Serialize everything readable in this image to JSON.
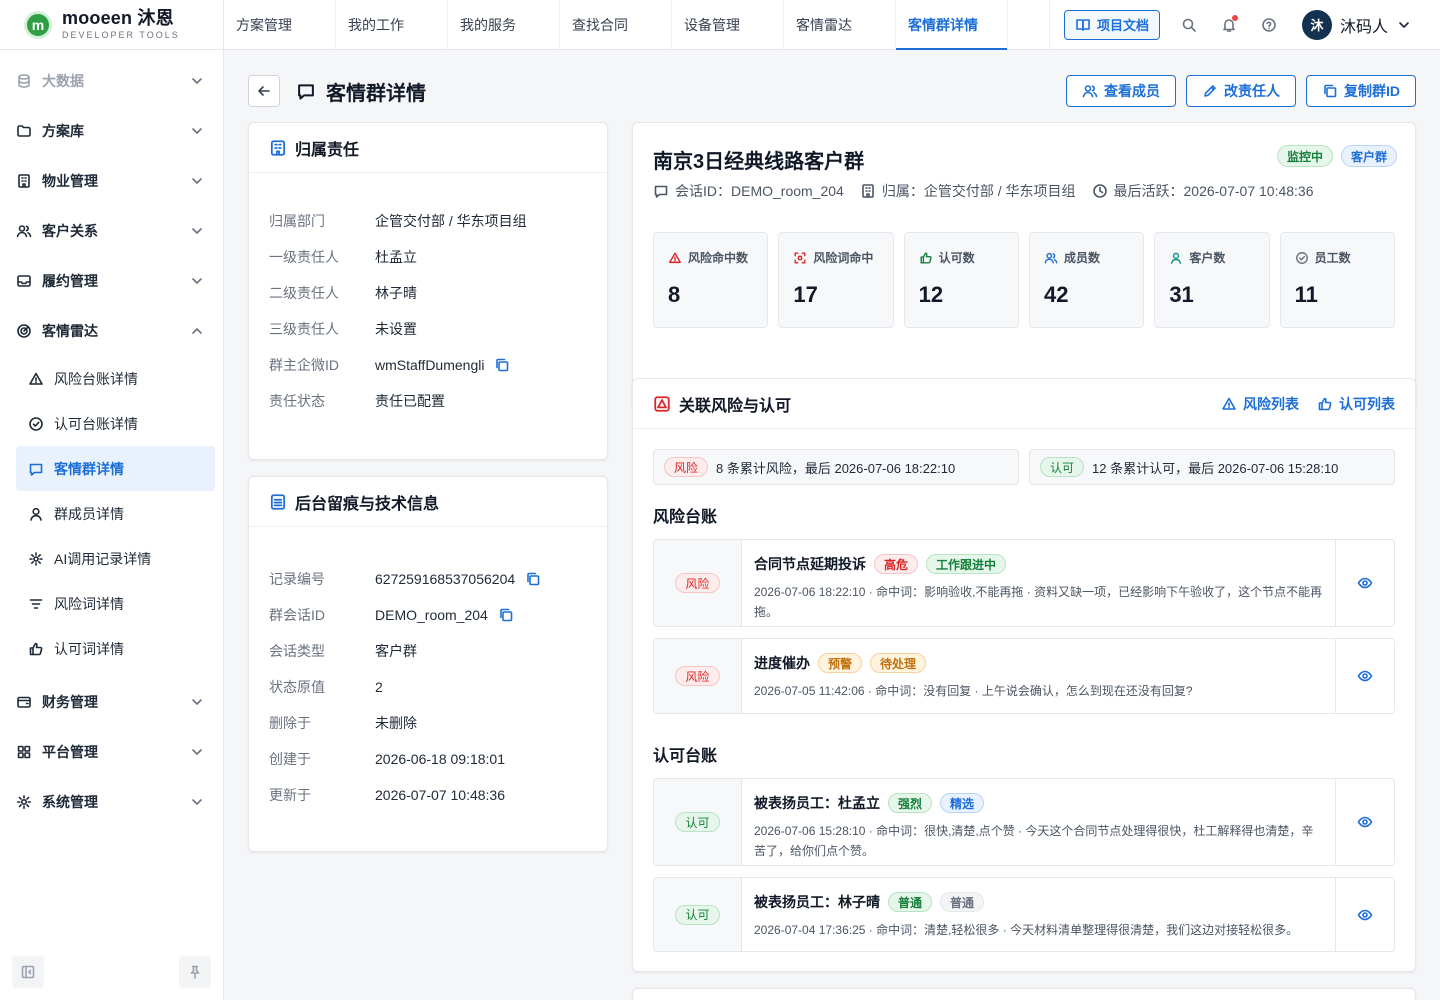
{
  "brand": {
    "name": "mooeen 沐恩",
    "subtitle": "DEVELOPER TOOLS",
    "logo_letter": "m"
  },
  "topnav": [
    {
      "label": "方案管理"
    },
    {
      "label": "我的工作"
    },
    {
      "label": "我的服务"
    },
    {
      "label": "查找合同"
    },
    {
      "label": "设备管理"
    },
    {
      "label": "客情雷达"
    },
    {
      "label": "客情群详情",
      "active": true
    }
  ],
  "topbar": {
    "doc_button": "项目文档",
    "user_initial": "沐",
    "user_name": "沐码人"
  },
  "sidebar": {
    "groups": [
      {
        "label": "大数据",
        "icon": "database-icon"
      },
      {
        "label": "方案库",
        "icon": "folder-icon"
      },
      {
        "label": "物业管理",
        "icon": "building-icon"
      },
      {
        "label": "客户关系",
        "icon": "users-icon"
      },
      {
        "label": "履约管理",
        "icon": "inbox-icon"
      },
      {
        "label": "客情雷达",
        "icon": "radar-icon"
      }
    ],
    "radar_items": [
      {
        "label": "风险台账详情",
        "icon": "warning-icon"
      },
      {
        "label": "认可台账详情",
        "icon": "check-circle-icon"
      },
      {
        "label": "客情群详情",
        "icon": "message-icon",
        "active": true
      },
      {
        "label": "群成员详情",
        "icon": "user-icon"
      },
      {
        "label": "AI调用记录详情",
        "icon": "ai-icon"
      },
      {
        "label": "风险词详情",
        "icon": "filter-icon"
      },
      {
        "label": "认可词详情",
        "icon": "thumbs-up-icon"
      }
    ],
    "bottom_groups": [
      {
        "label": "财务管理",
        "icon": "wallet-icon"
      },
      {
        "label": "平台管理",
        "icon": "grid-icon"
      },
      {
        "label": "系统管理",
        "icon": "gear-icon"
      }
    ]
  },
  "page": {
    "title": "客情群详情",
    "actions": [
      {
        "label": "查看成员",
        "icon": "users-icon"
      },
      {
        "label": "改责任人",
        "icon": "pencil-icon"
      },
      {
        "label": "复制群ID",
        "icon": "copy-icon"
      }
    ]
  },
  "ownership": {
    "title": "归属责任",
    "rows": [
      {
        "key": "归属部门",
        "value": "企管交付部 / 华东项目组"
      },
      {
        "key": "一级责任人",
        "value": "杜孟立"
      },
      {
        "key": "二级责任人",
        "value": "林子晴"
      },
      {
        "key": "三级责任人",
        "value": "未设置"
      },
      {
        "key": "群主企微ID",
        "value": "wmStaffDumengli",
        "copy": true
      },
      {
        "key": "责任状态",
        "value": "责任已配置"
      }
    ]
  },
  "tech": {
    "title": "后台留痕与技术信息",
    "rows": [
      {
        "key": "记录编号",
        "value": "627259168537056204",
        "copy": true
      },
      {
        "key": "群会话ID",
        "value": "DEMO_room_204",
        "copy": true
      },
      {
        "key": "会话类型",
        "value": "客户群"
      },
      {
        "key": "状态原值",
        "value": "2"
      },
      {
        "key": "删除于",
        "value": "未删除"
      },
      {
        "key": "创建于",
        "value": "2026-06-18 09:18:01"
      },
      {
        "key": "更新于",
        "value": "2026-07-07 10:48:36"
      }
    ]
  },
  "group": {
    "name": "南京3日经典线路客户群",
    "tags": [
      "监控中",
      "客户群"
    ],
    "meta": {
      "session": "会话ID：DEMO_room_204",
      "owner": "归属：企管交付部 / 华东项目组",
      "last_active": "最后活跃：2026-07-07 10:48:36"
    },
    "stats": [
      {
        "label": "风险命中数",
        "value": "8",
        "icon": "warning-icon",
        "color": "#dc2626"
      },
      {
        "label": "风险词命中",
        "value": "17",
        "icon": "scan-icon",
        "color": "#dc2626"
      },
      {
        "label": "认可数",
        "value": "12",
        "icon": "thumbs-up-icon",
        "color": "#16803d"
      },
      {
        "label": "成员数",
        "value": "42",
        "icon": "users-icon",
        "color": "#1d6fd8"
      },
      {
        "label": "客户数",
        "value": "31",
        "icon": "user-icon",
        "color": "#0d9488"
      },
      {
        "label": "员工数",
        "value": "11",
        "icon": "check-circle-icon",
        "color": "#6b7280"
      }
    ]
  },
  "related": {
    "title": "关联风险与认可",
    "links": [
      "风险列表",
      "认可列表"
    ],
    "risk_summary": {
      "tag": "风险",
      "text": "8 条累计风险，最后 2026-07-06 18:22:10"
    },
    "approval_summary": {
      "tag": "认可",
      "text": "12 条累计认可，最后 2026-07-06 15:28:10"
    },
    "risk_section": "风险台账",
    "approval_section": "认可台账",
    "risk_entries": [
      {
        "badge": "风险",
        "title": "合同节点延期投诉",
        "tags": [
          {
            "text": "高危",
            "color": "red"
          },
          {
            "text": "工作跟进中",
            "color": "green"
          }
        ],
        "desc": "2026-07-06 18:22:10 · 命中词：影响验收,不能再拖 · 资料又缺一项，已经影响下午验收了，这个节点不能再拖。"
      },
      {
        "badge": "风险",
        "title": "进度催办",
        "tags": [
          {
            "text": "预警",
            "color": "orange"
          },
          {
            "text": "待处理",
            "color": "orange"
          }
        ],
        "desc": "2026-07-05 11:42:06 · 命中词：没有回复 · 上午说会确认，怎么到现在还没有回复?"
      }
    ],
    "approval_entries": [
      {
        "badge": "认可",
        "title": "被表扬员工：杜孟立",
        "tags": [
          {
            "text": "强烈",
            "color": "green"
          },
          {
            "text": "精选",
            "color": "blue"
          }
        ],
        "desc": "2026-07-06 15:28:10 · 命中词：很快,清楚,点个赞 · 今天这个合同节点处理得很快，杜工解释得也清楚，辛苦了，给你们点个赞。"
      },
      {
        "badge": "认可",
        "title": "被表扬员工：林子晴",
        "tags": [
          {
            "text": "普通",
            "color": "green"
          },
          {
            "text": "普通",
            "color": "gray"
          }
        ],
        "desc": "2026-07-04 17:36:25 · 命中词：清楚,轻松很多 · 今天材料清单整理得很清楚，我们这边对接轻松很多。"
      }
    ]
  }
}
